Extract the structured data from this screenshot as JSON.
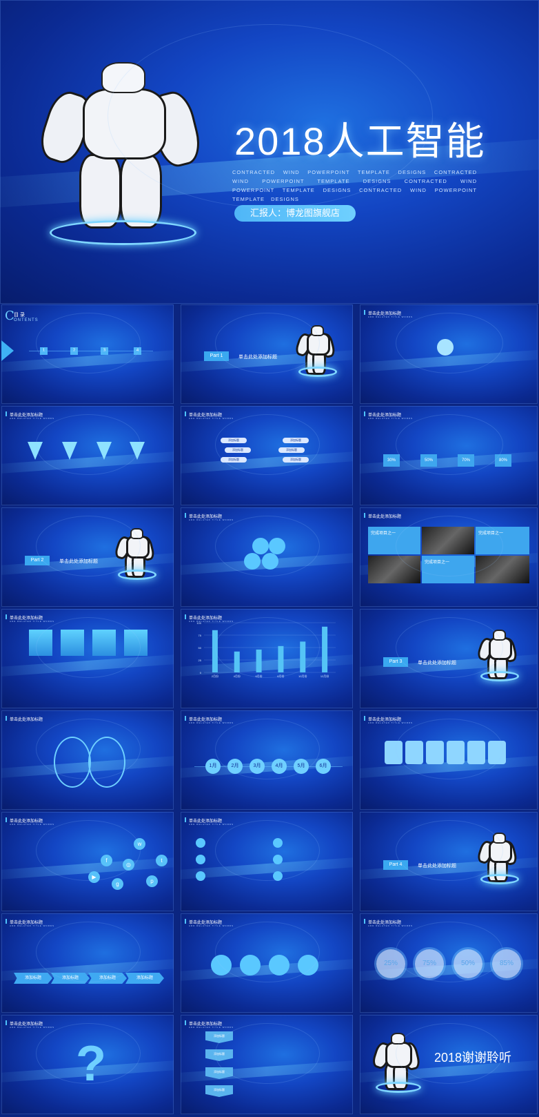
{
  "hero": {
    "title": "2018人工智能",
    "subtitle": "CONTRACTED WIND POWERPOINT TEMPLATE DESIGNS CONTRACTED WIND POWERPOINT TEMPLATE DESIGNS CONTRACTED WIND POWERPOINT TEMPLATE DESIGNS CONTRACTED WIND POWERPOINT TEMPLATE DESIGNS",
    "presenter": "汇报人：博龙图旗舰店"
  },
  "common": {
    "tile_title": "单击此处添加标题",
    "tile_sub": "ADD RELATED TITLE WORDS",
    "click_title": "单击此处添加标题",
    "add_title": "添加标题",
    "add_label": "添加标题"
  },
  "contents": {
    "mark": "C",
    "title": "目 录",
    "english": "ONTENTS",
    "numbers": [
      "1",
      "2",
      "3",
      "4"
    ]
  },
  "parts": [
    "Part 1",
    "Part 2",
    "Part 3",
    "Part 4"
  ],
  "percent_boxes": [
    "30%",
    "50%",
    "70%",
    "80%"
  ],
  "complete_items": [
    "完成项目之一",
    "完成项目之一",
    "完成项目之一"
  ],
  "months": [
    "1月",
    "2月",
    "3月",
    "4月",
    "5月",
    "6月"
  ],
  "rings": [
    "25%",
    "75%",
    "50%",
    "85%"
  ],
  "thanks": "2018谢谢聆听",
  "colors": {
    "accent": "#4fb6f7",
    "bg": "#0b2a93"
  },
  "chart_data": {
    "type": "bar",
    "categories": [
      "2月份",
      "4月份",
      "6月份",
      "8月份",
      "10月份",
      "12月份"
    ],
    "values": [
      85,
      42,
      46,
      53,
      62,
      92
    ],
    "ylim": [
      0,
      100
    ],
    "yticks": [
      "100",
      "75",
      "50",
      "25",
      "0"
    ]
  }
}
